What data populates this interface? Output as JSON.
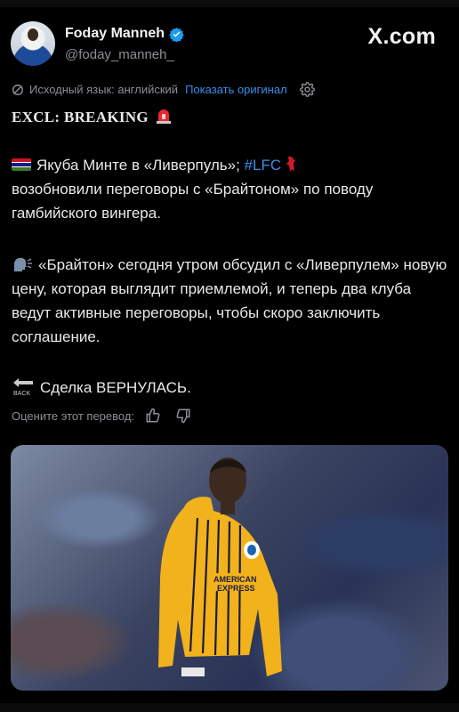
{
  "author": {
    "name": "Foday Manneh",
    "handle": "@foday_manneh_",
    "verified": true,
    "avatar_icon": "profile-photo"
  },
  "brand": {
    "logo_text": "X.com"
  },
  "translation": {
    "source_label": "Исходный язык: английский",
    "show_original": "Показать оригинал",
    "settings_icon": "gear-icon"
  },
  "tweet": {
    "title": "EXCL: BREAKING",
    "p1_before": "Якуба Минте в «Ливерпуль»; ",
    "p1_hashtag": "#LFC",
    "p1_after": "возобновили переговоры с «Брайтоном» по поводу гамбийского вингера.",
    "p2": "«Брайтон» сегодня утром обсудил с «Ливерпулем» новую цену, которая выглядит приемлемой, и теперь два клуба ведут активные переговоры, чтобы скоро заключить соглашение.",
    "p3": "Сделка ВЕРНУЛАСЬ."
  },
  "rating": {
    "label": "Оцените этот перевод:"
  },
  "media": {
    "alt": "Football player in yellow Brighton kit",
    "shirt_sponsor": "AMERICAN EXPRESS",
    "colors": {
      "kit": "#f2b21c",
      "stripes": "#1b1b3a"
    }
  },
  "colors": {
    "link": "#3b8ee9",
    "background": "#000000",
    "text": "#e7e9ea",
    "muted": "#8b9096"
  }
}
